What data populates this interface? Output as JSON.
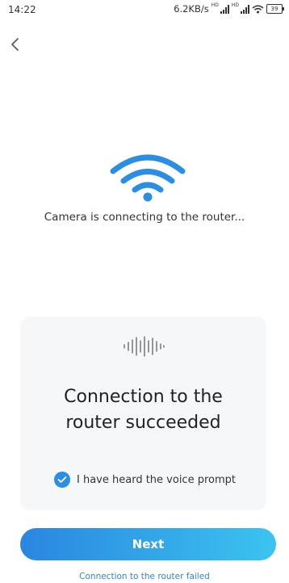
{
  "status_bar": {
    "time": "14:22",
    "net_speed": "6.2KB/s",
    "battery": "39"
  },
  "icons": {
    "back": "chevron-left-icon",
    "wifi": "wifi-icon",
    "voice": "voice-wave-icon",
    "check": "check-icon"
  },
  "main": {
    "connecting_text": "Camera is connecting to the router..."
  },
  "card": {
    "title_line1": "Connection to the",
    "title_line2": "router succeeded",
    "checkbox_label": "I have heard the voice prompt",
    "checkbox_checked": true
  },
  "actions": {
    "next_label": "Next",
    "failed_link": "Connection to the router failed"
  },
  "colors": {
    "accent": "#2a8fe3",
    "gradient_start": "#2a86e0",
    "gradient_end": "#3cc3f0",
    "card_bg": "#f6f7f9"
  }
}
